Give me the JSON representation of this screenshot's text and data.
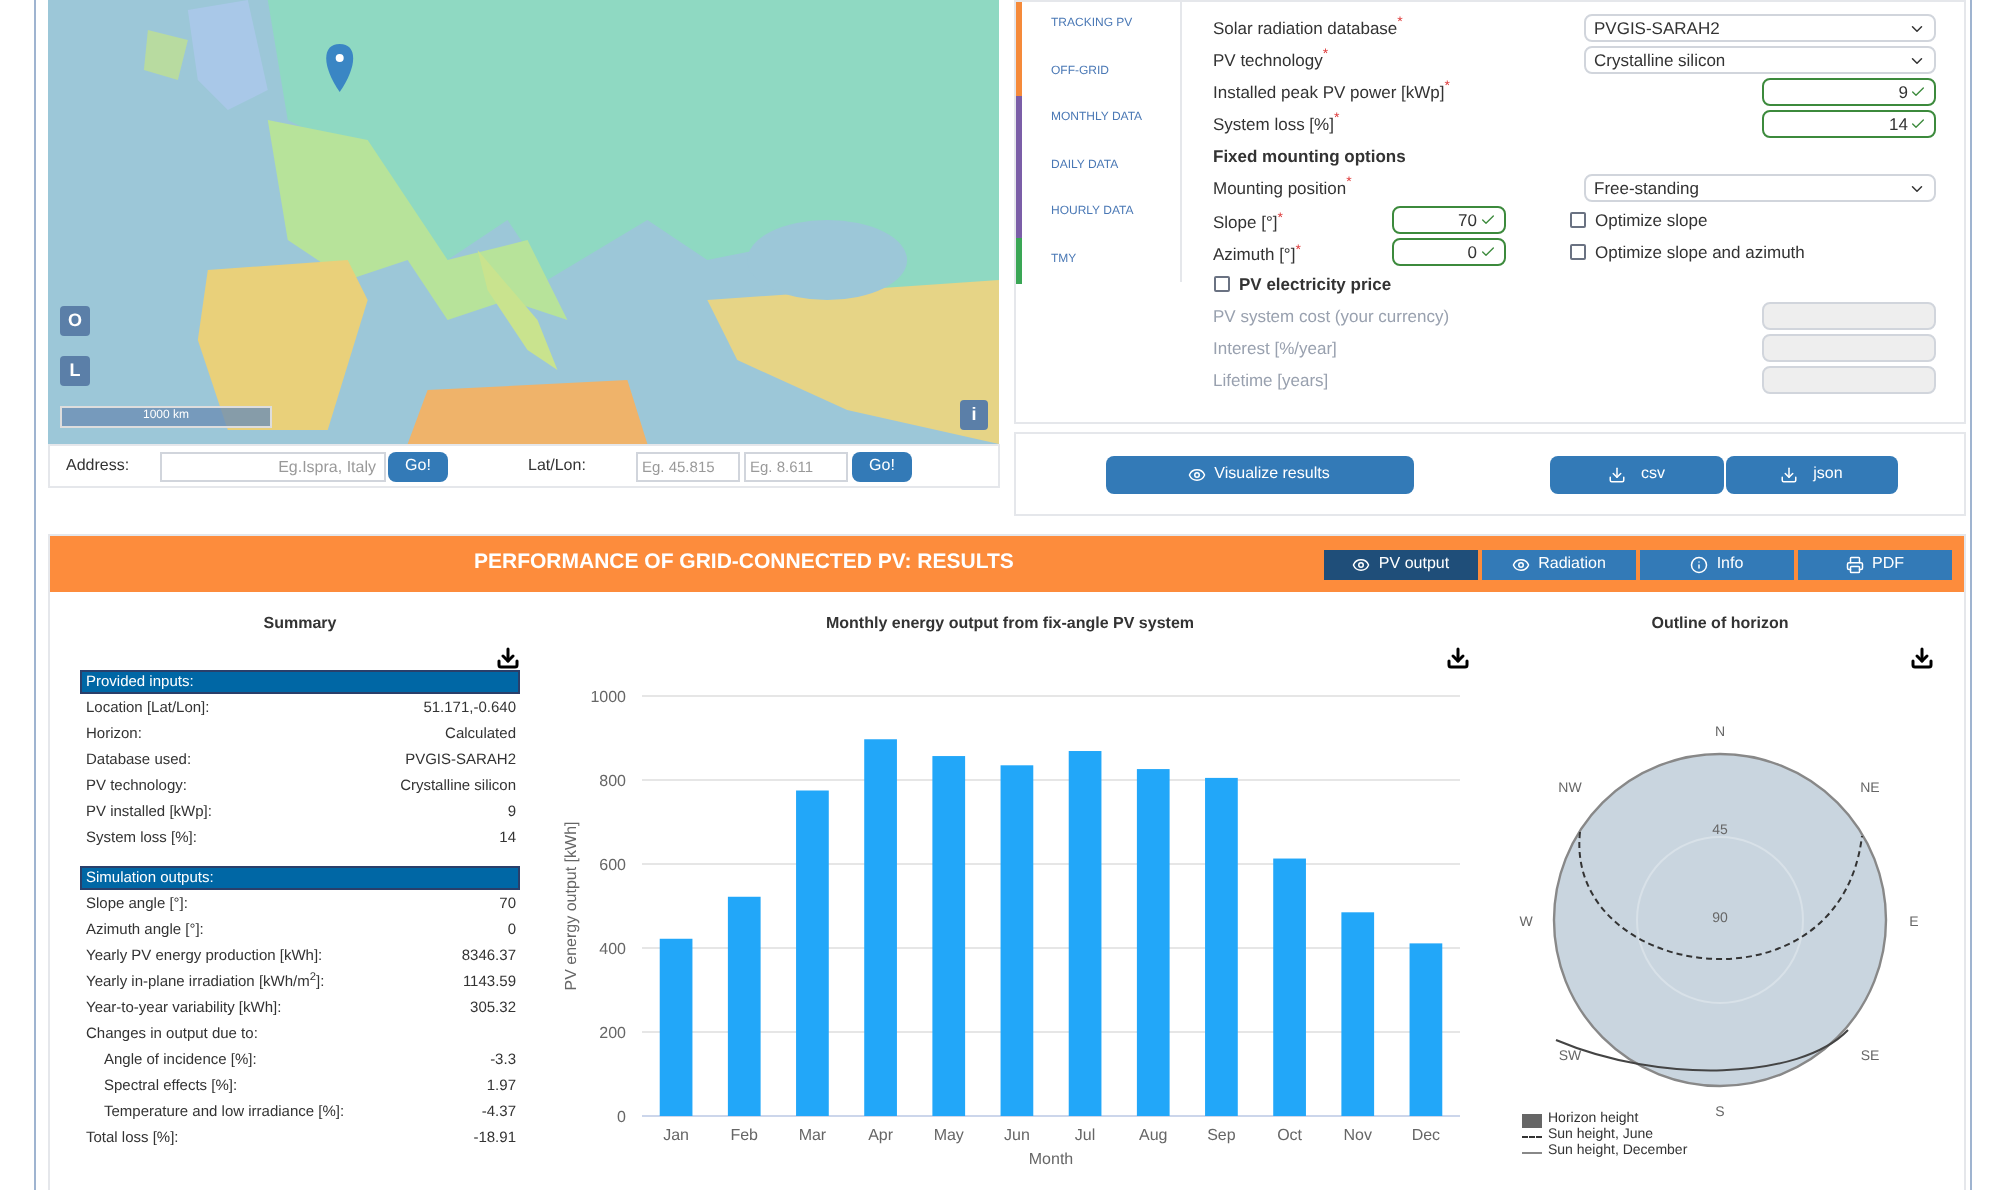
{
  "map": {
    "controls": [
      "O",
      "L"
    ],
    "scale": "1000 km",
    "info": "i"
  },
  "search": {
    "address_label": "Address:",
    "address_placeholder": "Eg.Ispra, Italy",
    "go": "Go!",
    "latlon_label": "Lat/Lon:",
    "lat_placeholder": "Eg. 45.815",
    "lon_placeholder": "Eg. 8.611",
    "go2": "Go!"
  },
  "side_tabs": [
    {
      "label": "TRACKING PV",
      "color": "#f58a3a",
      "selected": false
    },
    {
      "label": "OFF-GRID",
      "color": "#f58a3a",
      "selected": false
    },
    {
      "label": "MONTHLY DATA",
      "color": "#7b5ea7",
      "selected": false
    },
    {
      "label": "DAILY DATA",
      "color": "#7b5ea7",
      "selected": false
    },
    {
      "label": "HOURLY DATA",
      "color": "#7b5ea7",
      "selected": false
    },
    {
      "label": "TMY",
      "color": "#3aa655",
      "selected": false
    }
  ],
  "form": [
    {
      "kind": "select",
      "label": "Solar radiation database",
      "marker": "*",
      "value": "PVGIS-SARAH2"
    },
    {
      "kind": "select",
      "label": "PV technology",
      "marker": "*",
      "value": "Crystalline silicon"
    },
    {
      "kind": "input",
      "label": "Installed peak PV power [kWp]",
      "marker": "*",
      "value": "9"
    },
    {
      "kind": "input",
      "label": "System loss [%]",
      "marker": "*",
      "value": "14"
    },
    {
      "kind": "heading",
      "label": "Fixed mounting options"
    },
    {
      "kind": "select",
      "label": "Mounting position",
      "marker": "*",
      "value": "Free-standing"
    },
    {
      "kind": "angle",
      "label": "Slope [°]",
      "marker": "*",
      "value": "70",
      "option": "Optimize slope",
      "checked": false
    },
    {
      "kind": "angle",
      "label": "Azimuth [°]",
      "marker": "*",
      "value": "0",
      "option": "Optimize slope and azimuth",
      "checked": false
    },
    {
      "kind": "check",
      "label": "PV electricity price",
      "checked": false
    },
    {
      "kind": "disabled",
      "label": "PV system cost (your currency)"
    },
    {
      "kind": "disabled",
      "label": "Interest [%/year]"
    },
    {
      "kind": "disabled",
      "label": "Lifetime [years]"
    }
  ],
  "actions": {
    "visualize": "Visualize results",
    "csv": "csv",
    "json": "json"
  },
  "results": {
    "title": "PERFORMANCE OF GRID-CONNECTED PV: RESULTS",
    "tabs": [
      {
        "label": "PV output",
        "selected": true
      },
      {
        "label": "Radiation",
        "selected": false
      },
      {
        "label": "Info",
        "selected": false
      },
      {
        "label": "PDF",
        "selected": false
      }
    ]
  },
  "summary": {
    "title": "Summary",
    "sections": [
      {
        "heading": "Provided inputs:",
        "rows": [
          {
            "label": "Location [Lat/Lon]:",
            "value": "51.171,-0.640"
          },
          {
            "label": "Horizon:",
            "value": "Calculated"
          },
          {
            "label": "Database used:",
            "value": "PVGIS-SARAH2"
          },
          {
            "label": "PV technology:",
            "value": "Crystalline silicon"
          },
          {
            "label": "PV installed [kWp]:",
            "value": "9"
          },
          {
            "label": "System loss [%]:",
            "value": "14"
          }
        ]
      },
      {
        "heading": "Simulation outputs:",
        "rows": [
          {
            "label": "Slope angle [°]:",
            "value": "70"
          },
          {
            "label": "Azimuth angle [°]:",
            "value": "0"
          },
          {
            "label": "Yearly PV energy production [kWh]:",
            "value": "8346.37"
          },
          {
            "label": "Yearly in-plane irradiation [kWh/m$^{2}$]:",
            "value": "1143.59"
          },
          {
            "label": "Year-to-year variability [kWh]:",
            "value": "305.32"
          },
          {
            "label": "Changes in output due to:",
            "children": [
              {
                "label": "Angle of incidence [%]:",
                "value": "-3.3"
              },
              {
                "label": "Spectral effects [%]:",
                "value": "1.97"
              },
              {
                "label": "Temperature and low irradiance [%]:",
                "value": "-4.37"
              }
            ]
          },
          {
            "label": "Total loss [%]:",
            "value": "-18.91"
          }
        ]
      }
    ]
  },
  "monthly": {
    "chart_data": {
      "type": "bar",
      "title": "Monthly energy output from fix-angle PV system",
      "xlabel": "Month",
      "ylabel": "PV energy output [kWh]",
      "categories": [
        "Jan",
        "Feb",
        "Mar",
        "Apr",
        "May",
        "Jun",
        "Jul",
        "Aug",
        "Sep",
        "Oct",
        "Nov",
        "Dec"
      ],
      "grid": true,
      "series": [
        {
          "color": "#22a7f9",
          "values": [
            422,
            522,
            775,
            897,
            857,
            835,
            869,
            826,
            805,
            613,
            485,
            411
          ]
        }
      ],
      "ylim": [
        0,
        1000
      ],
      "yticks": [
        0,
        200,
        400,
        600,
        800,
        1000
      ]
    }
  },
  "horizon": {
    "title": "Outline of horizon",
    "directions": [
      "N",
      "NE",
      "E",
      "SE",
      "S",
      "SW",
      "W",
      "NW"
    ],
    "rings": [
      "45",
      "90"
    ],
    "legend": [
      {
        "kind": "box",
        "label": "Horizon height"
      },
      {
        "kind": "dashed",
        "label": "Sun height, June"
      },
      {
        "kind": "line",
        "label": "Sun height, December"
      }
    ]
  }
}
